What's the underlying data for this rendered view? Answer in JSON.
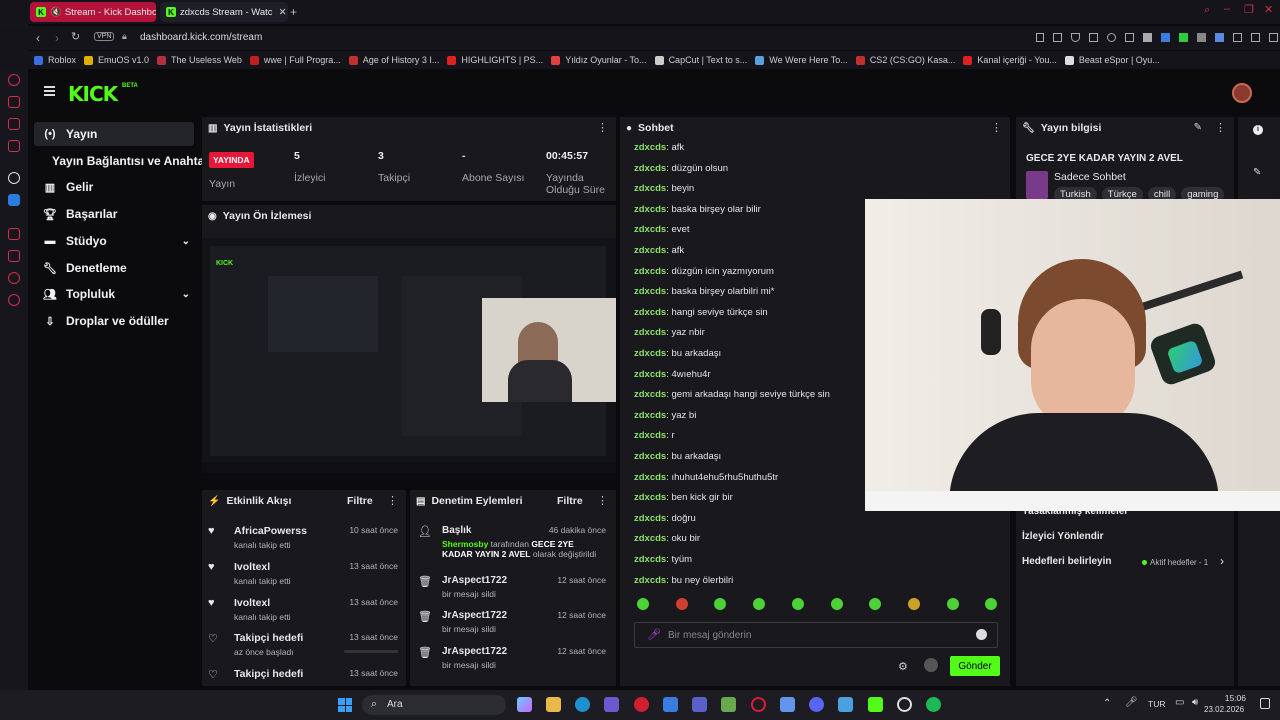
{
  "browser": {
    "tabs": [
      {
        "title": "Stream - Kick Dashbo",
        "active": true
      },
      {
        "title": "zdxcds Stream - Watc",
        "active": false
      }
    ],
    "url": "dashboard.kick.com/stream",
    "vpn_label": "VPN",
    "bookmarks": [
      {
        "label": "Roblox",
        "icon_color": "#3b6fe0"
      },
      {
        "label": "EmuOS v1.0",
        "icon_color": "#e0b000"
      },
      {
        "label": "The Useless Web",
        "icon_color": "#b03040"
      },
      {
        "label": "wwe | Full Progra...",
        "icon_color": "#c02020"
      },
      {
        "label": "Age of History 3 I...",
        "icon_color": "#c03030"
      },
      {
        "label": "HIGHLIGHTS | PS...",
        "icon_color": "#e02020"
      },
      {
        "label": "Yıldız Oyunlar - To...",
        "icon_color": "#e04040"
      },
      {
        "label": "CapCut | Text to s...",
        "icon_color": "#cccccc"
      },
      {
        "label": "We Were Here To...",
        "icon_color": "#5aa0e0"
      },
      {
        "label": "CS2 (CS:GO) Kasa...",
        "icon_color": "#c03030"
      },
      {
        "label": "Kanal içeriği - You...",
        "icon_color": "#e02020"
      },
      {
        "label": "Beast eSpor | Oyu...",
        "icon_color": "#dddddd"
      }
    ]
  },
  "sidebar": {
    "logo_text": "KICK",
    "logo_badge": "BETA",
    "items": [
      {
        "label": "Yayın",
        "icon": "broadcast-icon",
        "active": true
      },
      {
        "label": "Yayın Bağlantısı ve Anahtarı",
        "icon": "",
        "active": false
      },
      {
        "label": "Gelir",
        "icon": "chart-icon",
        "active": false
      },
      {
        "label": "Başarılar",
        "icon": "trophy-icon",
        "active": false
      },
      {
        "label": "Stüdyo",
        "icon": "studio-icon",
        "active": false,
        "expandable": true
      },
      {
        "label": "Denetleme",
        "icon": "wrench-icon",
        "active": false
      },
      {
        "label": "Topluluk",
        "icon": "community-icon",
        "active": false,
        "expandable": true
      },
      {
        "label": "Droplar ve ödüller",
        "icon": "drops-icon",
        "active": false
      }
    ]
  },
  "stats": {
    "header": "Yayın İstatistikleri",
    "live_badge": "YAYINDA",
    "live_label": "Yayın",
    "items": [
      {
        "value": "5",
        "label": "İzleyici"
      },
      {
        "value": "3",
        "label": "Takipçi"
      },
      {
        "value": "-",
        "label": "Abone Sayısı"
      },
      {
        "value": "00:45:57",
        "label": "Yayında Olduğu Süre"
      }
    ]
  },
  "preview": {
    "header": "Yayın Ön İzlemesi"
  },
  "activity": {
    "header": "Etkinlik Akışı",
    "filter_label": "Filtre",
    "items": [
      {
        "title": "AfricaPowerss",
        "sub": "kanalı takip etti",
        "time": "10 saat önce"
      },
      {
        "title": "Ivoltexl",
        "sub": "kanalı takip etti",
        "time": "13 saat önce"
      },
      {
        "title": "Ivoltexl",
        "sub": "kanalı takip etti",
        "time": "13 saat önce"
      },
      {
        "title": "Takipçi hedefi",
        "sub": "az önce başladı",
        "time": "13 saat önce"
      },
      {
        "title": "Takipçi hedefi",
        "sub": "",
        "time": "13 saat önce"
      }
    ]
  },
  "moderation": {
    "header": "Denetim Eylemleri",
    "filter_label": "Filtre",
    "items": [
      {
        "title": "Başlık",
        "time": "46 dakika önce",
        "actor": "Shermosby",
        "middle": " tarafından ",
        "target": "GECE 2YE KADAR YAYIN 2 AVEL",
        "tail": " olarak değiştirildi"
      },
      {
        "title": "JrAspect1722",
        "sub": "bir mesajı sildi",
        "time": "12 saat önce"
      },
      {
        "title": "JrAspect1722",
        "sub": "bir mesajı sildi",
        "time": "12 saat önce"
      },
      {
        "title": "JrAspect1722",
        "sub": "bir mesajı sildi",
        "time": "12 saat önce"
      }
    ]
  },
  "chat": {
    "header": "Sohbet",
    "messages": [
      {
        "user": "zdxcds",
        "text": "afk"
      },
      {
        "user": "zdxcds",
        "text": "düzgün olsun"
      },
      {
        "user": "zdxcds",
        "text": "beyin"
      },
      {
        "user": "zdxcds",
        "text": "baska birşey olar bilir"
      },
      {
        "user": "zdxcds",
        "text": "evet"
      },
      {
        "user": "zdxcds",
        "text": "afk"
      },
      {
        "user": "zdxcds",
        "text": "düzgün icin yazmıyorum"
      },
      {
        "user": "zdxcds",
        "text": "baska birşey olarbilri mi*"
      },
      {
        "user": "zdxcds",
        "text": "hangi seviye türkçe sin"
      },
      {
        "user": "zdxcds",
        "text": "yaz nbir"
      },
      {
        "user": "zdxcds",
        "text": "bu arkadaşı"
      },
      {
        "user": "zdxcds",
        "text": "4wıehu4r"
      },
      {
        "user": "zdxcds",
        "text": "gemi arkadaşı hangi seviye türkçe sin"
      },
      {
        "user": "zdxcds",
        "text": "yaz bi"
      },
      {
        "user": "zdxcds",
        "text": "r"
      },
      {
        "user": "zdxcds",
        "text": "bu arkadaşı"
      },
      {
        "user": "zdxcds",
        "text": "ıhuhut4ehu5rhu5huthu5tr"
      },
      {
        "user": "zdxcds",
        "text": "ben kick gir bir"
      },
      {
        "user": "zdxcds",
        "text": "doğru"
      },
      {
        "user": "zdxcds",
        "text": "oku bir"
      },
      {
        "user": "zdxcds",
        "text": "tyüm"
      },
      {
        "user": "zdxcds",
        "text": "bu ney ölerbilri"
      }
    ],
    "input_placeholder": "Bir mesaj gönderin",
    "send_label": "Gönder"
  },
  "stream_info": {
    "header": "Yayın bilgisi",
    "title": "GECE 2YE KADAR YAYIN 2 AVEL",
    "category": "Sadece Sohbet",
    "tags": [
      "Turkish",
      "Türkçe",
      "chill",
      "gaming"
    ],
    "banned_words": "Yasaklanmış kelimeler",
    "redirect": "İzleyici Yönlendir",
    "goals": "Hedefleri belirleyin",
    "goals_status": "Aktif hedefler - 1"
  },
  "taskbar": {
    "search_label": "Ara",
    "lang": "TUR",
    "time": "15:06",
    "date": "23.02.2026"
  },
  "colors": {
    "accent": "#53fc18",
    "live": "#e8173a",
    "user": "#8be06b"
  }
}
